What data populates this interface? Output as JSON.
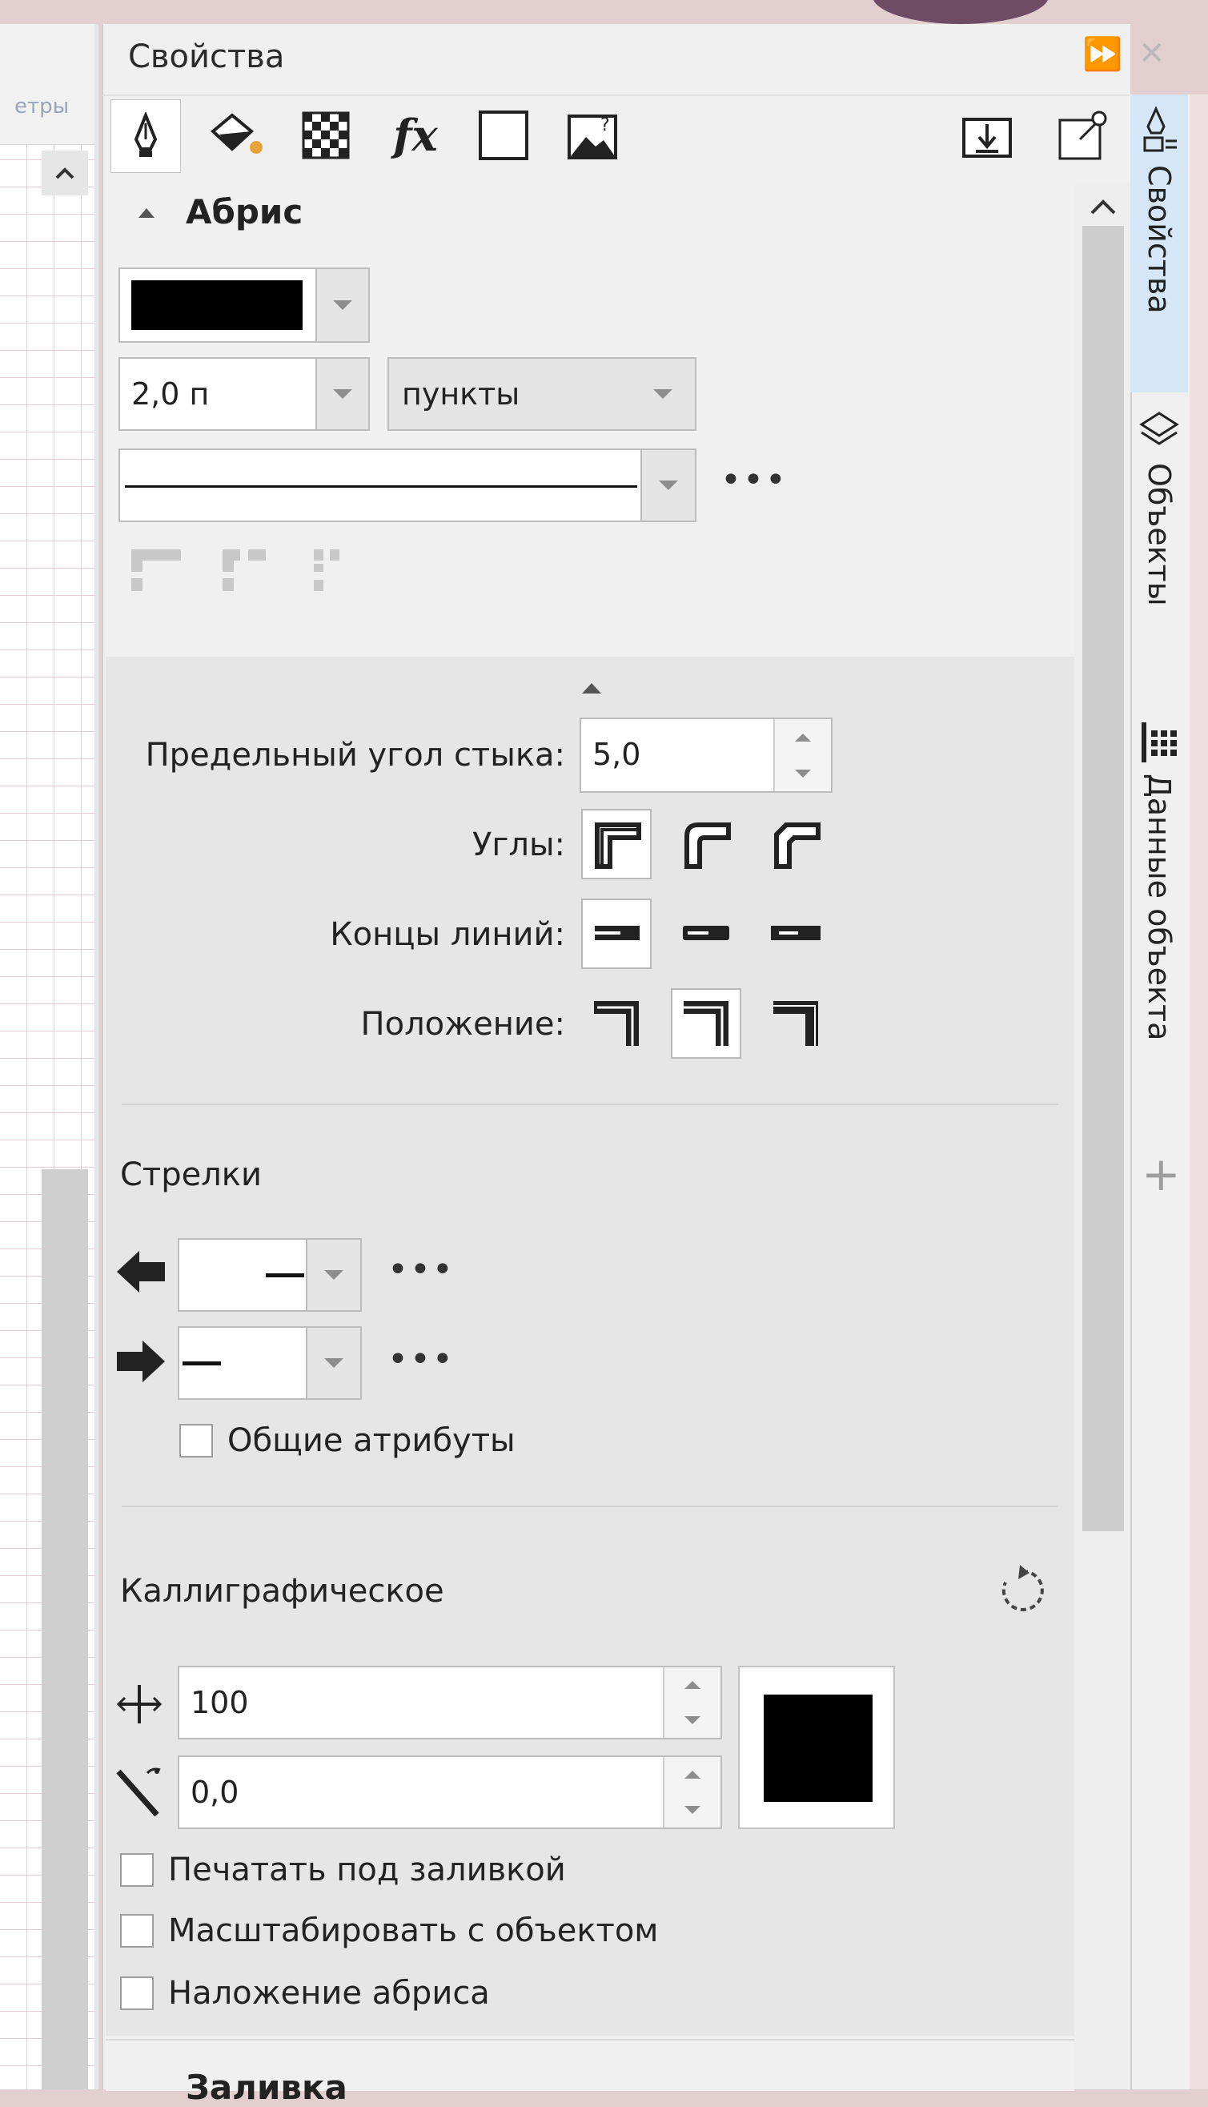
{
  "window": {
    "title": "Свойства",
    "left_panel_label": "етры"
  },
  "tabs": [
    {
      "icon": "outline-pen-icon",
      "active": true
    },
    {
      "icon": "fill-bucket-icon",
      "active": false
    },
    {
      "icon": "transparency-icon",
      "active": false
    },
    {
      "icon": "effects-fx-icon",
      "active": false
    },
    {
      "icon": "frame-icon",
      "active": false
    },
    {
      "icon": "image-icon",
      "active": false
    }
  ],
  "outline": {
    "section_title": "Абрис",
    "color": "#000000",
    "width_value": "2,0 п",
    "units_value": "пункты",
    "miter_label": "Предельный угол стыка:",
    "miter_value": "5,0",
    "corners_label": "Углы:",
    "line_caps_label": "Концы линий:",
    "position_label": "Положение:",
    "selected_corner": 0,
    "selected_cap": 0,
    "selected_position": 1
  },
  "arrows": {
    "title": "Стрелки",
    "shared_attributes_label": "Общие атрибуты",
    "shared_attributes_checked": false
  },
  "calligraphic": {
    "title": "Каллиграфическое",
    "stretch_value": "100",
    "angle_value": "0,0",
    "nib_color": "#000000",
    "print_behind_label": "Печатать под заливкой",
    "scale_with_object_label": "Масштабировать с объектом",
    "overprint_label": "Наложение абриса"
  },
  "dock_tabs": [
    {
      "label": "Свойства",
      "icon": "properties-icon",
      "active": true
    },
    {
      "label": "Объекты",
      "icon": "layers-icon",
      "active": false
    },
    {
      "label": "Данные объекта",
      "icon": "data-grid-icon",
      "active": false
    }
  ],
  "next_section_partial": "Заливка"
}
